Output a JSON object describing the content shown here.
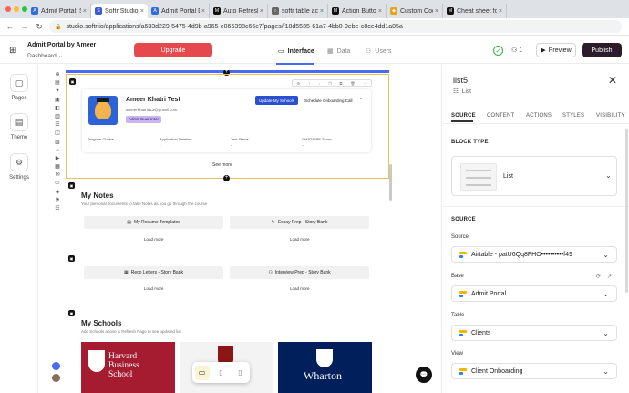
{
  "browser": {
    "tabs": [
      {
        "label": "Admit Portal: S",
        "color": "#2f6fdc",
        "glyph": "A"
      },
      {
        "label": "Softr Studio",
        "color": "#3b5bdb",
        "glyph": "S",
        "active": true
      },
      {
        "label": "Admit Portal D",
        "color": "#2f6fdc",
        "glyph": "A"
      },
      {
        "label": "Auto Refresh l",
        "color": "#111111",
        "glyph": "M"
      },
      {
        "label": "softr table acti",
        "color": "#666666",
        "glyph": "○"
      },
      {
        "label": "Action Button",
        "color": "#111111",
        "glyph": "M"
      },
      {
        "label": "Custom Code",
        "color": "#e8a317",
        "glyph": "◆"
      },
      {
        "label": "Cheat sheet fo",
        "color": "#111111",
        "glyph": "M"
      }
    ],
    "url": "studio.softr.io/applications/a633d229-5475-4d9b-a965-e065398c66c7/pages/f18d5535-61a7-4bb0-9ebe-c8ce4dd1a05a"
  },
  "header": {
    "app_name": "Admit Portal by Ameer",
    "page_name": "Dashboard",
    "upgrade_label": "Upgrade",
    "tabs": [
      {
        "label": "Interface",
        "icon": "▭"
      },
      {
        "label": "Data",
        "icon": "▦"
      },
      {
        "label": "Users",
        "icon": "⚇"
      }
    ],
    "user_count": "1",
    "preview_label": "Preview",
    "publish_label": "Publish"
  },
  "rail": [
    {
      "label": "Pages",
      "icon": "▢"
    },
    {
      "label": "Theme",
      "icon": "▤"
    },
    {
      "label": "Settings",
      "icon": "⚙"
    }
  ],
  "canvas": {
    "profile": {
      "name": "Ameer Khatri Test",
      "email": "ameerkhatri613@gmail.com",
      "badge": "Admit Guarantor",
      "update_btn": "Update My Schools",
      "schedule_btn": "Schedule Onboarding Call",
      "fields": [
        {
          "label": "Program Choice",
          "value": "-"
        },
        {
          "label": "Application Timeline",
          "value": "-"
        },
        {
          "label": "Test Status",
          "value": "-"
        },
        {
          "label": "GMAT/GRE Score",
          "value": "-"
        }
      ],
      "see_more": "See more"
    },
    "notes": {
      "title": "My Notes",
      "subtitle": "Your personal documents to take Notes as you go through the course",
      "row1": [
        "My Resume Templates",
        "Essay Prep - Story Bank"
      ],
      "row2": [
        "Reco Letters - Story Bank",
        "Interview Prep - Story Bank"
      ],
      "load_more": "Load more"
    },
    "schools": {
      "title": "My Schools",
      "subtitle": "Add Schools above & Refresh Page to see updated list",
      "harvard": [
        "Harvard",
        "Business",
        "School"
      ],
      "wharton": "Wharton"
    }
  },
  "panel": {
    "title": "list5",
    "subtitle": "List",
    "tabs": [
      "SOURCE",
      "CONTENT",
      "ACTIONS",
      "STYLES",
      "VISIBILITY"
    ],
    "block_type_heading": "BLOCK TYPE",
    "block_type": "List",
    "source_heading": "SOURCE",
    "source_label": "Source",
    "source_value": "Airtable - patU6Qq8FHO••••••••••f49",
    "base_label": "Base",
    "base_value": "Admit Portal",
    "table_label": "Table",
    "table_value": "Clients",
    "view_label": "View",
    "view_value": "Client Onboarding"
  }
}
